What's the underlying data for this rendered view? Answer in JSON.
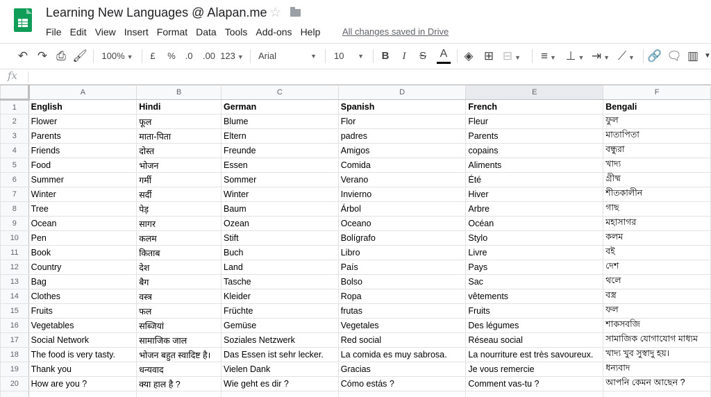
{
  "app": {
    "document_title": "Learning New Languages @ Alapan.me",
    "save_status": "All changes saved in Drive",
    "menu": [
      "File",
      "Edit",
      "View",
      "Insert",
      "Format",
      "Data",
      "Tools",
      "Add-ons",
      "Help"
    ]
  },
  "toolbar": {
    "zoom": "100%",
    "currency": "£",
    "percent": "%",
    "decrease_decimals": ".0",
    "increase_decimals": ".00",
    "more_formats": "123",
    "font": "Arial",
    "font_size": "10",
    "bold": "B",
    "italic": "I",
    "strikethrough": "S",
    "text_color": "A",
    "text_color_hex": "#000000",
    "icons": [
      "undo-icon",
      "redo-icon",
      "print-icon",
      "paint-format-icon",
      "fill-color-icon",
      "borders-icon",
      "merge-cells-icon",
      "align-horizontal-icon",
      "align-vertical-icon",
      "text-wrap-icon",
      "text-rotation-icon",
      "link-icon",
      "comment-icon",
      "chart-icon"
    ]
  },
  "formula_bar": {
    "label": "fx",
    "value": ""
  },
  "sheet": {
    "columns": [
      "A",
      "B",
      "C",
      "D",
      "E",
      "F"
    ],
    "selected_column": "E",
    "row_numbers": [
      "1",
      "2",
      "3",
      "4",
      "5",
      "6",
      "7",
      "8",
      "9",
      "10",
      "11",
      "12",
      "13",
      "14",
      "15",
      "16",
      "17",
      "18",
      "19",
      "20",
      ""
    ],
    "rows": [
      [
        "English",
        "Hindi",
        "German",
        "Spanish",
        "French",
        "Bengali"
      ],
      [
        "Flower",
        "फूल",
        "Blume",
        "Flor",
        "Fleur",
        "ফুল"
      ],
      [
        "Parents",
        "माता-पिता",
        "Eltern",
        "padres",
        "Parents",
        "মাতাপিতা"
      ],
      [
        "Friends",
        "दोस्त",
        "Freunde",
        "Amigos",
        "copains",
        "বন্ধুরা"
      ],
      [
        "Food",
        "भोजन",
        "Essen",
        "Comida",
        "Aliments",
        "খাদ্য"
      ],
      [
        "Summer",
        "गर्मी",
        "Sommer",
        "Verano",
        "Été",
        "গ্রীষ্ম"
      ],
      [
        "Winter",
        "सर्दी",
        "Winter",
        "Invierno",
        "Hiver",
        "শীতকালীন"
      ],
      [
        "Tree",
        "पेड़",
        "Baum",
        "Árbol",
        "Arbre",
        "গাছ"
      ],
      [
        "Ocean",
        "सागर",
        "Ozean",
        "Oceano",
        "Océan",
        "মহাসাগর"
      ],
      [
        "Pen",
        "कलम",
        "Stift",
        "Bolígrafo",
        "Stylo",
        "কলম"
      ],
      [
        "Book",
        "किताब",
        "Buch",
        "Libro",
        "Livre",
        "বই"
      ],
      [
        "Country",
        "देश",
        "Land",
        "País",
        "Pays",
        "দেশ"
      ],
      [
        "Bag",
        "बैग",
        "Tasche",
        "Bolso",
        "Sac",
        "থলে"
      ],
      [
        "Clothes",
        "वस्त्र",
        "Kleider",
        "Ropa",
        "vêtements",
        "বস্ত্র"
      ],
      [
        "Fruits",
        "फल",
        "Früchte",
        "frutas",
        "Fruits",
        "ফল"
      ],
      [
        "Vegetables",
        "सब्जियां",
        "Gemüse",
        "Vegetales",
        "Des légumes",
        "শাকসবজি"
      ],
      [
        "Social Network",
        "सामाजिक जाल",
        "Soziales Netzwerk",
        "Red social",
        "Réseau social",
        "সামাজিক যোগাযোগ মাধ্যম"
      ],
      [
        "The food is very tasty.",
        "भोजन बहुत स्वादिष्ट है।",
        "Das Essen ist sehr lecker.",
        "La comida es muy sabrosa.",
        "La nourriture est très savoureux.",
        "খাদ্য খুব সুস্বাদু হয়।"
      ],
      [
        "Thank you",
        "धन्यवाद",
        "Vielen Dank",
        "Gracias",
        "Je vous remercie",
        "ধন্যবাদ"
      ],
      [
        "How are you ?",
        "क्या हाल है ?",
        "Wie geht es dir ?",
        "Cómo estás ?",
        "Comment vas-tu ?",
        "আপনি কেমন আছেন ?"
      ],
      [
        "",
        "",
        "",
        "",
        "",
        ""
      ]
    ]
  }
}
